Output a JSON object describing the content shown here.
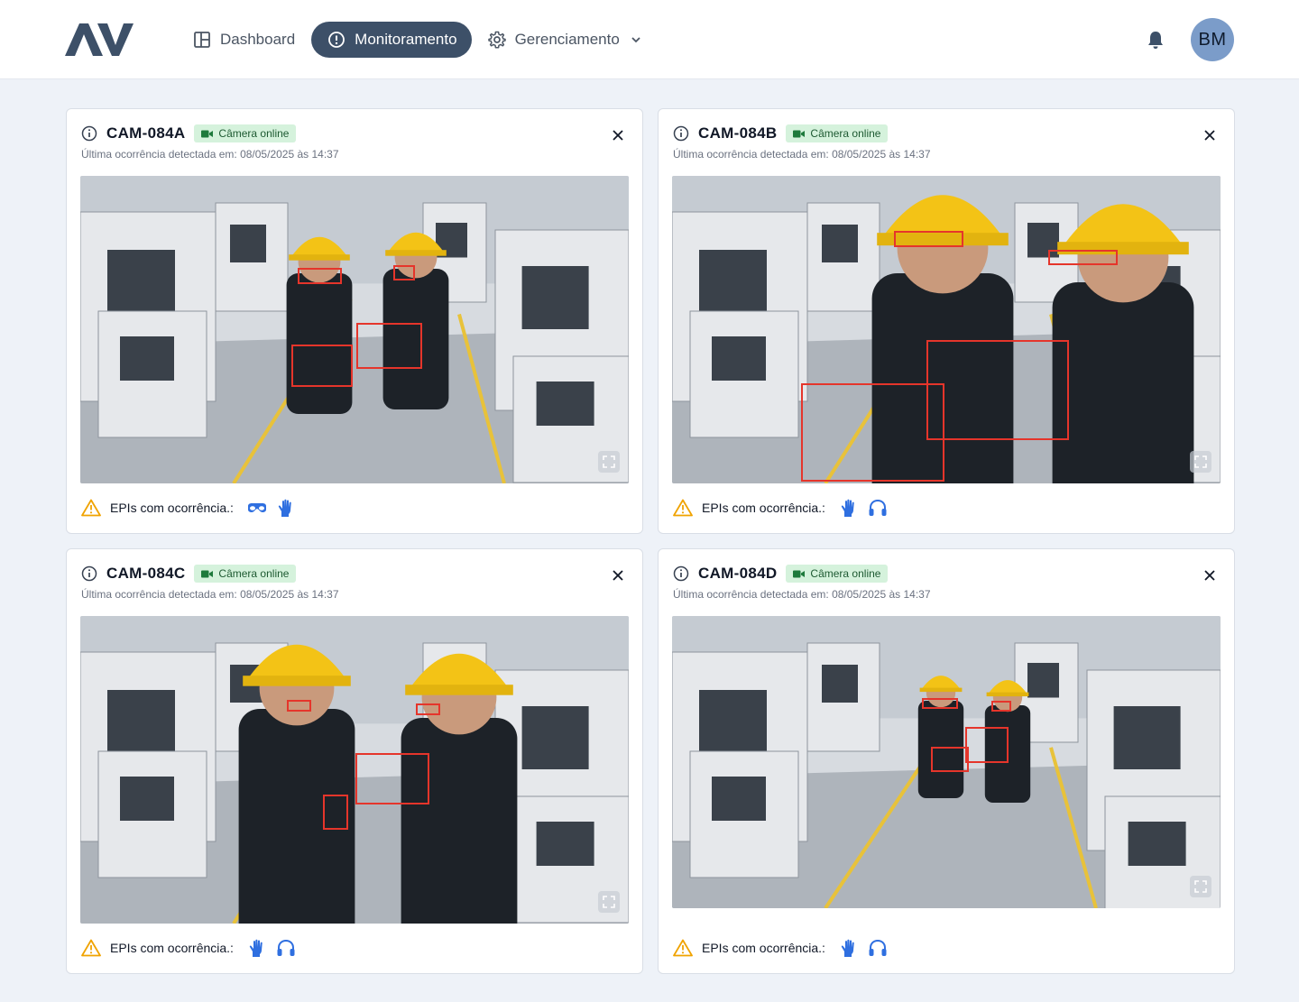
{
  "header": {
    "logo_text": "AV",
    "nav": [
      {
        "label": "Dashboard",
        "icon": "layout-icon",
        "active": false
      },
      {
        "label": "Monitoramento",
        "icon": "alert-circle-icon",
        "active": true
      },
      {
        "label": "Gerenciamento",
        "icon": "gear-icon",
        "active": false
      }
    ],
    "avatar_initials": "BM"
  },
  "colors": {
    "nav_active_bg": "#3d5068",
    "badge_bg": "#d5f2dc",
    "detection_box": "#e5352b",
    "warning": "#f0a300",
    "epi_icon": "#2f6fe0"
  },
  "cameras": [
    {
      "name": "CAM-084A",
      "status": "Câmera online",
      "last_event": "Última ocorrência detectada em: 08/05/2025 às 14:37",
      "epi_label": "EPIs com ocorrência.:",
      "epis": [
        "goggles-icon",
        "glove-icon"
      ]
    },
    {
      "name": "CAM-084B",
      "status": "Câmera online",
      "last_event": "Última ocorrência detectada em: 08/05/2025 às 14:37",
      "epi_label": "EPIs com ocorrência.:",
      "epis": [
        "glove-icon",
        "ear-protection-icon"
      ]
    },
    {
      "name": "CAM-084C",
      "status": "Câmera online",
      "last_event": "Última ocorrência detectada em: 08/05/2025 às 14:37",
      "epi_label": "EPIs com ocorrência.:",
      "epis": [
        "glove-icon",
        "ear-protection-icon"
      ]
    },
    {
      "name": "CAM-084D",
      "status": "Câmera online",
      "last_event": "Última ocorrência detectada em: 08/05/2025 às 14:37",
      "epi_label": "EPIs com ocorrência.:",
      "epis": [
        "glove-icon",
        "ear-protection-icon"
      ]
    }
  ]
}
